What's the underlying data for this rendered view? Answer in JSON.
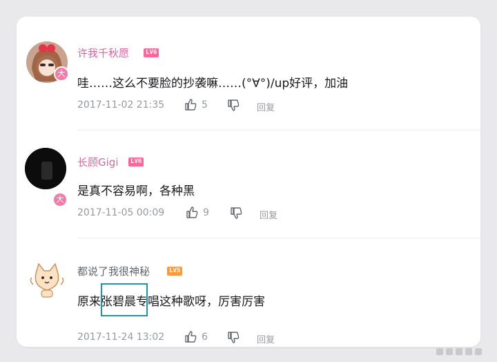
{
  "comments": [
    {
      "username": "许我千秋愿",
      "level": "LV6",
      "badge": "大",
      "text": "哇……这么不要脸的抄袭嘛……(°∀°)/up好评，加油",
      "time": "2017-11-02 21:35",
      "likes": "5",
      "reply_label": "回复"
    },
    {
      "username": "长顾Gigi",
      "level": "LV6",
      "badge": "大",
      "text": "是真不容易啊，各种黑",
      "time": "2017-11-05 00:09",
      "likes": "9",
      "reply_label": "回复"
    },
    {
      "username": "都说了我很神秘",
      "level": "LV5",
      "text_before": "原来",
      "text_highlight": "张碧晨",
      "text_after": "专唱这种歌呀，厉害厉害",
      "time": "2017-11-24 13:02",
      "likes": "6",
      "reply_label": "回复"
    }
  ],
  "colors": {
    "username": "#fb7299",
    "username_plain": "#61666d",
    "lv6": "#ff6699",
    "lv5": "#ff9a3b",
    "highlight_border": "#1a95a8"
  },
  "icons": [
    "like-icon",
    "dislike-icon",
    "vip-badge-icon"
  ]
}
